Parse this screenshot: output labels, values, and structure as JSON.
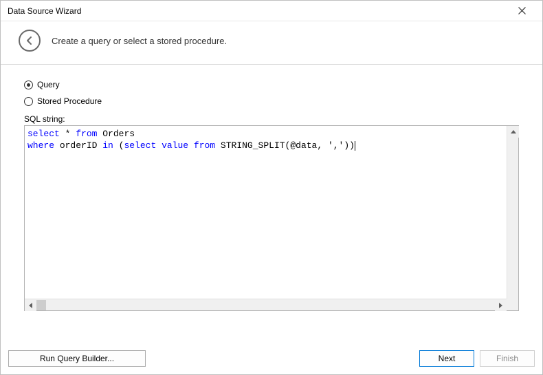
{
  "window": {
    "title": "Data Source Wizard"
  },
  "header": {
    "subtitle": "Create a query or select a stored procedure."
  },
  "radios": {
    "query": {
      "label": "Query",
      "selected": true
    },
    "storedProc": {
      "label": "Stored Procedure",
      "selected": false
    }
  },
  "sqlField": {
    "label": "SQL string:",
    "keywords": [
      "select",
      "from",
      "where",
      "in",
      "value"
    ],
    "line1_kw1": "select",
    "line1_t1": " * ",
    "line1_kw2": "from",
    "line1_t2": " Orders",
    "line2_kw1": "where",
    "line2_t1": " orderID ",
    "line2_kw2": "in",
    "line2_t2": " (",
    "line2_kw3": "select",
    "line2_t3": " ",
    "line2_kw4": "value",
    "line2_t4": " ",
    "line2_kw5": "from",
    "line2_t5": " STRING_SPLIT(@data, ','))"
  },
  "buttons": {
    "runQueryBuilder": "Run Query Builder...",
    "next": "Next",
    "finish": "Finish"
  }
}
